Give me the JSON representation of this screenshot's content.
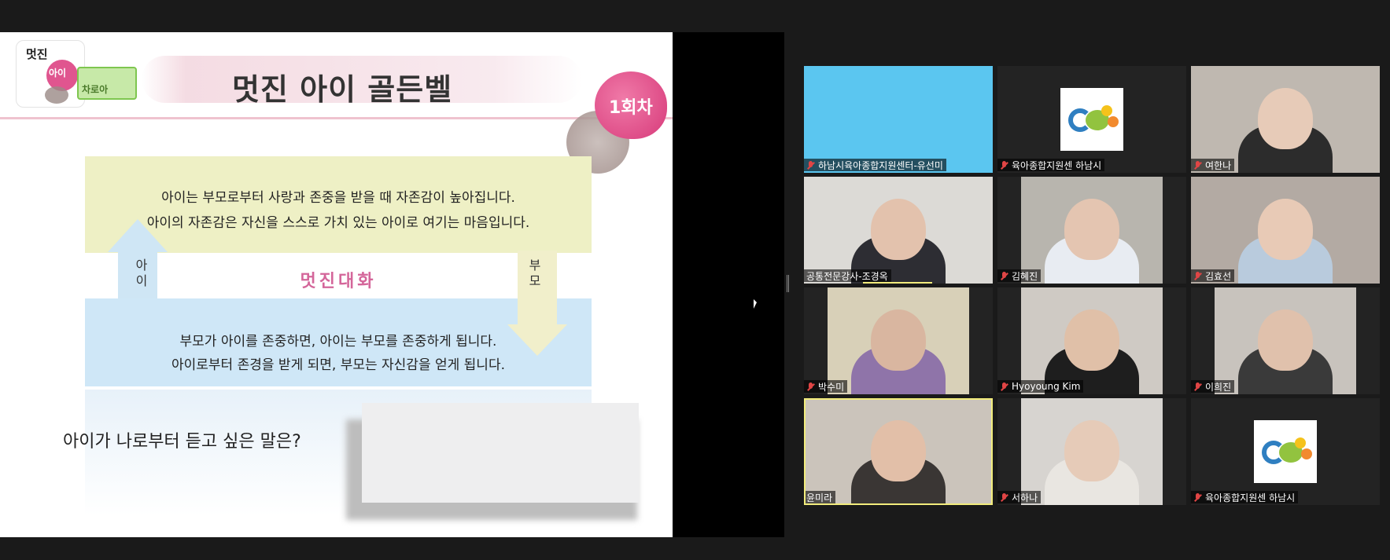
{
  "slide": {
    "logo_text": "멋진",
    "logo_badge": "아이",
    "sign_text": "차로아",
    "title": "멋진 아이 골든벨",
    "session_label": "1회차",
    "top_box": {
      "line1": "아이는 부모로부터 사랑과 존중을 받을 때 자존감이 높아집니다.",
      "line2": "아이의 자존감은 자신을 스스로 가치 있는 아이로 여기는 마음입니다."
    },
    "center_text": "멋진대화",
    "left_arrow_label": "아\n이",
    "right_arrow_label": "부\n모",
    "bottom_box": {
      "line1": "부모가 아이를 존중하면, 아이는 부모를 존중하게 됩니다.",
      "line2": "아이로부터 존경을 받게 되면, 부모는 자신감을 얻게 됩니다."
    },
    "question": "아이가 나로부터 듣고 싶은 말은?"
  },
  "participants": [
    {
      "name": "하남시육아종합지원센터-유선미",
      "muted": true,
      "kind": "color",
      "bg": "#5bc6f0"
    },
    {
      "name": "육아종합지원센 하남시",
      "muted": true,
      "kind": "logo"
    },
    {
      "name": "여한나",
      "muted": true,
      "kind": "photo",
      "bg": "#bfb8b0",
      "face": "#e7cbb8",
      "body": "#2c2c2c"
    },
    {
      "name": "공통전문강사-조경옥",
      "muted": false,
      "kind": "photo",
      "bg": "#dcdad6",
      "face": "#e3c2ad",
      "body": "#2d2d33",
      "speaking": true
    },
    {
      "name": "김혜진",
      "muted": true,
      "kind": "photo",
      "bg": "#b8b5ae",
      "face": "#e4c5b1",
      "body": "#e8ecf2"
    },
    {
      "name": "김효선",
      "muted": true,
      "kind": "photo",
      "bg": "#b3aaa3",
      "face": "#e8cab6",
      "body": "#b9cbdd"
    },
    {
      "name": "박수미",
      "muted": true,
      "kind": "photo",
      "bg": "#d8d0b8",
      "face": "#d9b6a0",
      "body": "#8f74a9"
    },
    {
      "name": "Hyoyoung Kim",
      "muted": true,
      "kind": "photo",
      "bg": "#cfcac4",
      "face": "#e0c0a8",
      "body": "#1e1e1e"
    },
    {
      "name": "이희진",
      "muted": true,
      "kind": "photo",
      "bg": "#c8c3bd",
      "face": "#e0c1ac",
      "body": "#3a3a3a"
    },
    {
      "name": "윤미라",
      "muted": false,
      "kind": "photo",
      "bg": "#cbc4bb",
      "face": "#e2bfa8",
      "body": "#3a3634",
      "active": true
    },
    {
      "name": "서하나",
      "muted": true,
      "kind": "photo",
      "bg": "#d7d4d0",
      "face": "#e6cbb8",
      "body": "#e9e6e1"
    },
    {
      "name": "육아종합지원센 하남시",
      "muted": true,
      "kind": "logo"
    }
  ]
}
